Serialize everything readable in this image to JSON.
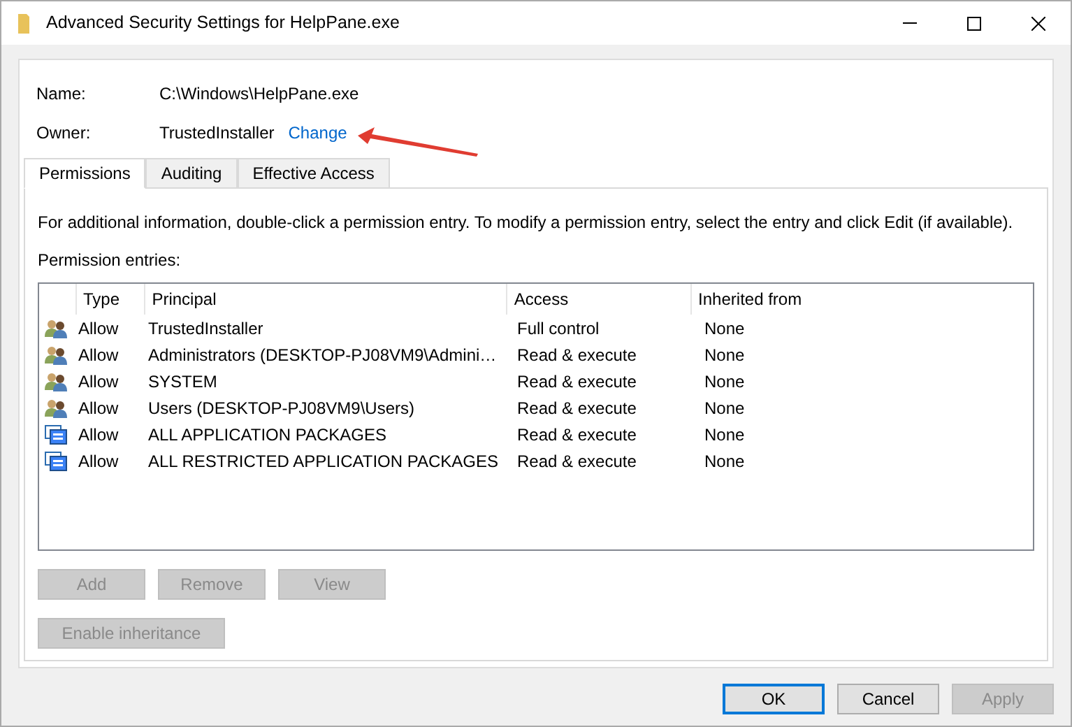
{
  "window": {
    "title": "Advanced Security Settings for HelpPane.exe"
  },
  "fields": [
    {
      "label": "Name:",
      "value": "C:\\Windows\\HelpPane.exe"
    },
    {
      "label": "Owner:",
      "value": "TrustedInstaller",
      "link": "Change"
    }
  ],
  "tabs": [
    {
      "label": "Permissions",
      "selected": true
    },
    {
      "label": "Auditing",
      "selected": false
    },
    {
      "label": "Effective Access",
      "selected": false
    }
  ],
  "info": "For additional information, double-click a permission entry. To modify a permission entry, select the entry and click Edit (if available).",
  "list_label": "Permission entries:",
  "table": {
    "columns": [
      "Type",
      "Principal",
      "Access",
      "Inherited from"
    ],
    "rows": [
      {
        "kind": "user",
        "type": "Allow",
        "principal": "TrustedInstaller",
        "access": "Full control",
        "inherited": "None"
      },
      {
        "kind": "user",
        "type": "Allow",
        "principal": "Administrators (DESKTOP-PJ08VM9\\Admini…",
        "access": "Read & execute",
        "inherited": "None"
      },
      {
        "kind": "user",
        "type": "Allow",
        "principal": "SYSTEM",
        "access": "Read & execute",
        "inherited": "None"
      },
      {
        "kind": "user",
        "type": "Allow",
        "principal": "Users (DESKTOP-PJ08VM9\\Users)",
        "access": "Read & execute",
        "inherited": "None"
      },
      {
        "kind": "package",
        "type": "Allow",
        "principal": "ALL APPLICATION PACKAGES",
        "access": "Read & execute",
        "inherited": "None"
      },
      {
        "kind": "package",
        "type": "Allow",
        "principal": "ALL RESTRICTED APPLICATION PACKAGES",
        "access": "Read & execute",
        "inherited": "None"
      }
    ]
  },
  "entry_buttons": [
    {
      "label": "Add",
      "disabled": true
    },
    {
      "label": "Remove",
      "disabled": true
    },
    {
      "label": "View",
      "disabled": true
    }
  ],
  "inheritance_button": {
    "label": "Enable inheritance",
    "disabled": true
  },
  "dialog_buttons": [
    {
      "label": "OK",
      "disabled": false,
      "default": true
    },
    {
      "label": "Cancel",
      "disabled": false,
      "default": false
    },
    {
      "label": "Apply",
      "disabled": true,
      "default": false
    }
  ]
}
